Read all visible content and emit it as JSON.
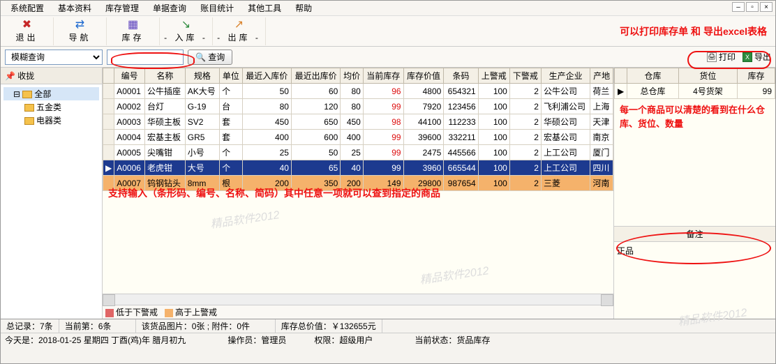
{
  "menu": [
    "系统配置",
    "基本资料",
    "库存管理",
    "单据查询",
    "账目统计",
    "其他工具",
    "帮助"
  ],
  "toolbar": [
    {
      "icon": "✖",
      "cls": "red",
      "label": "退出"
    },
    {
      "icon": "⇄",
      "cls": "blue",
      "label": "导航"
    },
    {
      "icon": "▦",
      "cls": "purple",
      "label": "库存"
    },
    {
      "icon": "↘",
      "cls": "green",
      "label": "- 入库 -"
    },
    {
      "icon": "↗",
      "cls": "orange",
      "label": "- 出库 -"
    }
  ],
  "anno_top_right": "可以打印库存单 和 导出excel表格",
  "search": {
    "mode": "模糊查询",
    "query_btn": "查询",
    "print": "打印",
    "export": "导出"
  },
  "left": {
    "hdr": "收拢",
    "root": "全部",
    "kids": [
      "五金类",
      "电器类"
    ]
  },
  "cols": [
    "编号",
    "名称",
    "规格",
    "单位",
    "最近入库价",
    "最近出库价",
    "均价",
    "当前库存",
    "库存价值",
    "条码",
    "上警戒",
    "下警戒",
    "生产企业",
    "产地"
  ],
  "rows": [
    {
      "c": [
        "A0001",
        "公牛插座",
        "AK大号",
        "个",
        "50",
        "60",
        "80",
        "96",
        "4800",
        "654321",
        "100",
        "2",
        "公牛公司",
        "荷兰"
      ],
      "red": [
        7
      ]
    },
    {
      "c": [
        "A0002",
        "台灯",
        "G-19",
        "台",
        "80",
        "120",
        "80",
        "99",
        "7920",
        "123456",
        "100",
        "2",
        "飞利浦公司",
        "上海"
      ],
      "red": [
        7
      ]
    },
    {
      "c": [
        "A0003",
        "华硕主板",
        "SV2",
        "套",
        "450",
        "650",
        "450",
        "98",
        "44100",
        "112233",
        "100",
        "2",
        "华硕公司",
        "天津"
      ],
      "red": [
        7
      ]
    },
    {
      "c": [
        "A0004",
        "宏基主板",
        "GR5",
        "套",
        "400",
        "600",
        "400",
        "99",
        "39600",
        "332211",
        "100",
        "2",
        "宏基公司",
        "南京"
      ],
      "red": [
        7
      ]
    },
    {
      "c": [
        "A0005",
        "尖嘴钳",
        "小号",
        "个",
        "25",
        "50",
        "25",
        "99",
        "2475",
        "445566",
        "100",
        "2",
        "上工公司",
        "厦门"
      ],
      "red": [
        7
      ]
    },
    {
      "c": [
        "A0006",
        "老虎钳",
        "大号",
        "个",
        "40",
        "65",
        "40",
        "99",
        "3960",
        "665544",
        "100",
        "2",
        "上工公司",
        "四川"
      ],
      "sel": true
    },
    {
      "c": [
        "A0007",
        "钨钢钻头",
        "8mm",
        "根",
        "200",
        "350",
        "200",
        "149",
        "29800",
        "987654",
        "100",
        "2",
        "三菱",
        "河南"
      ],
      "orange": true
    }
  ],
  "anno_mid": "支持输入（条形码、编号、名称、简码）其中任意一项就可以查到指定的商品",
  "legend": {
    "low": "低于下警戒",
    "high": "高于上警戒"
  },
  "right": {
    "cols": [
      "仓库",
      "货位",
      "库存"
    ],
    "row": [
      "总仓库",
      "4号货架",
      "99"
    ],
    "anno": "每一个商品可以清楚的看到在什么仓库、货位、数量",
    "notes_h": "备注",
    "notes_v": "正品"
  },
  "status1": {
    "total": "总记录：7条",
    "page": "当前第：6条",
    "attach": "该货品图片：0张 ; 附件：0件",
    "value": "库存总价值：￥132655元"
  },
  "status2": {
    "date": "今天是：2018-01-25 星期四 丁酉(鸡)年 腊月初九",
    "op": "操作员：管理员",
    "priv": "权限：超级用户",
    "state": "当前状态：货品库存"
  },
  "watermark": "精品软件2012"
}
